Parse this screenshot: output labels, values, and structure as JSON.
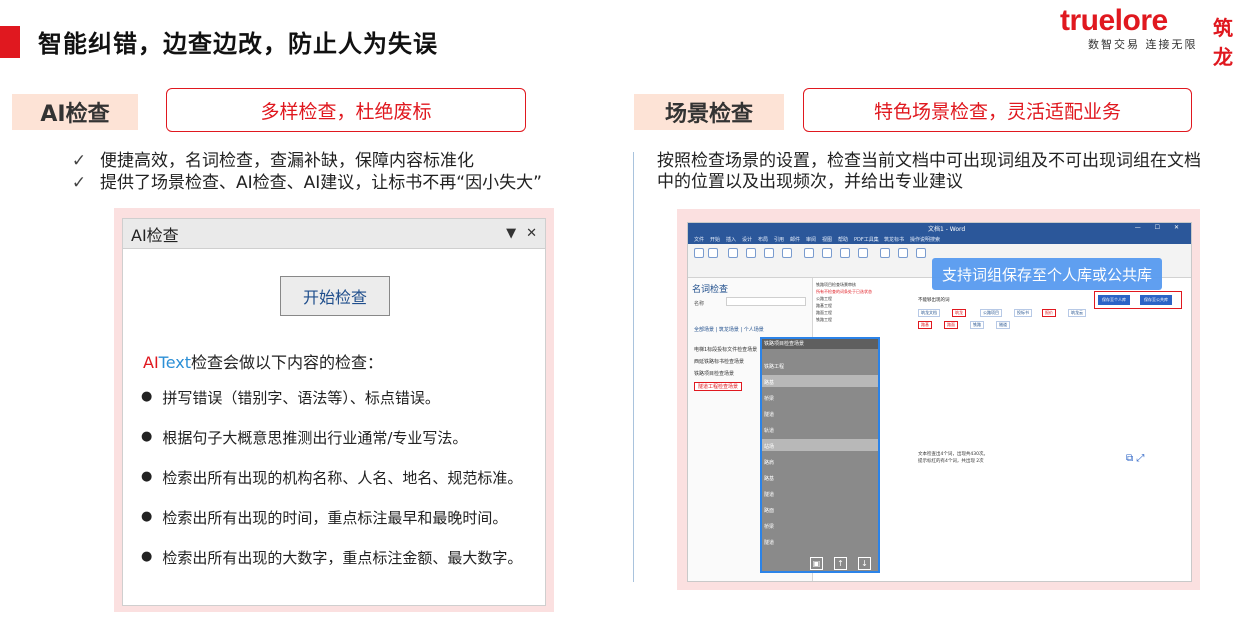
{
  "header": {
    "title": "智能纠错，边查边改，防止人为失误",
    "logo": {
      "brand": "truelore",
      "brand_cn": "筑龙",
      "slogan": "数智交易 连接无限"
    }
  },
  "left": {
    "tag": "AI检查",
    "callout": "多样检查，杜绝废标",
    "bullets": [
      "便捷高效，名词检查，查漏补缺，保障内容标准化",
      "提供了场景检查、AI检查、AI建议，让标书不再“因小失大”"
    ],
    "panel": {
      "title": "AI检查",
      "start_button": "开始检查",
      "intro_ai": "AI",
      "intro_text": "Text",
      "intro_rest": "检查会做以下内容的检查：",
      "items": [
        "拼写错误（错别字、语法等）、标点错误。",
        "根据句子大概意思推测出行业通常/专业写法。",
        "检索出所有出现的机构名称、人名、地名、规范标准。",
        "检索出所有出现的时间，重点标注最早和最晚时间。",
        "检索出所有出现的大数字，重点标注金额、最大数字。"
      ]
    }
  },
  "right": {
    "tag": "场景检查",
    "callout": "特色场景检查，灵活适配业务",
    "description": "按照检查场景的设置，检查当前文档中可出现词组及不可出现词组在文档中的位置以及出现频次，并给出专业建议",
    "shot": {
      "doc_title": "文档1 - Word",
      "sys_controls": "— ☐ ✕",
      "menu": [
        "文件",
        "开始",
        "插入",
        "设计",
        "布局",
        "引用",
        "邮件",
        "审阅",
        "视图",
        "帮助",
        "PDF工具集",
        "筑龙标书",
        "操作说明搜索"
      ],
      "pane_title": "名词检查",
      "name_label": "名称",
      "tabs": "全部场景 | 筑龙场景 | 个人场景",
      "scenes": [
        "电梯1标段投标文件检查场景",
        "西延铁路标书检查场景",
        "铁路项目检查场景",
        "隧道工程检查场景"
      ],
      "doc_lines": [
        "铁路项目检查场景审核",
        "所有不检查的词条处于已选状态",
        "公路工程",
        "路基工程",
        "路面工程",
        "铁路工程"
      ],
      "must_not_label": "不能够出现的词",
      "chips_row1": [
        "筑龙文档",
        "筑龙",
        "公路项目",
        "投标书",
        "报价",
        "筑龙云"
      ],
      "chips_row2": [
        "路基",
        "路面",
        "铁路",
        "隧道"
      ],
      "save_personal": "保存至个人库",
      "save_public": "保存至公共库",
      "stats": [
        "文本检查出4个词，出现共430次。",
        "提示标红的有4个词，共出现 2次"
      ],
      "float_title": "铁路项目检查场景",
      "float_items": [
        "铁路工程",
        "路基",
        "桥梁",
        "隧道",
        "轨道",
        "站场",
        "路肩",
        "路基",
        "隧道",
        "路面",
        "桥梁",
        "隧道",
        "路基"
      ],
      "balloon": "支持词组保存至个人库或公共库"
    }
  }
}
